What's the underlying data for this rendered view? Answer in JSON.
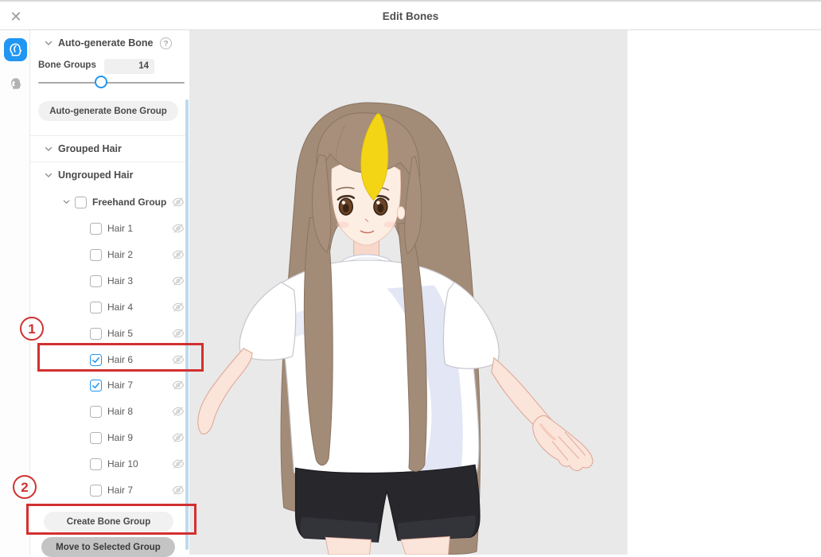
{
  "window": {
    "title": "Edit Bones"
  },
  "topbar": {
    "close_icon": "✕"
  },
  "tool_rail": {
    "tools": [
      {
        "name": "hair-bone-tool",
        "active": true
      },
      {
        "name": "face-tool",
        "active": false
      }
    ]
  },
  "sidebar": {
    "auto_generate": {
      "title": "Auto-generate Bone",
      "help_icon": "?",
      "bone_groups_label": "Bone Groups",
      "bone_groups_value": "14",
      "slider": {
        "percent": 43
      },
      "generate_button": "Auto-generate Bone Group"
    },
    "grouped_section": {
      "label": "Grouped Hair"
    },
    "ungrouped_section": {
      "label": "Ungrouped Hair"
    },
    "freehand_group": {
      "label": "Freehand Group",
      "checked": false
    },
    "hair_items": [
      {
        "label": "Hair 1",
        "checked": false
      },
      {
        "label": "Hair 2",
        "checked": false
      },
      {
        "label": "Hair 3",
        "checked": false
      },
      {
        "label": "Hair 4",
        "checked": false
      },
      {
        "label": "Hair 5",
        "checked": false
      },
      {
        "label": "Hair 6",
        "checked": true
      },
      {
        "label": "Hair 7",
        "checked": true
      },
      {
        "label": "Hair 8",
        "checked": false
      },
      {
        "label": "Hair 9",
        "checked": false
      },
      {
        "label": "Hair 10",
        "checked": false
      },
      {
        "label": "Hair 7",
        "checked": false
      }
    ],
    "create_button": "Create Bone Group",
    "move_button": "Move to Selected Group"
  },
  "annotations": {
    "color": "#d23030",
    "step1": {
      "number": "1"
    },
    "step2": {
      "number": "2"
    }
  },
  "colors": {
    "accent": "#2196f3",
    "canvas_bg": "#e9e9e9",
    "scrollbar": "#bcdcee",
    "hair": "#a28b77",
    "hair_streak": "#f4d515",
    "shirt": "#ffffff",
    "shorts": "#27272c",
    "skin": "#fbe4d9"
  }
}
